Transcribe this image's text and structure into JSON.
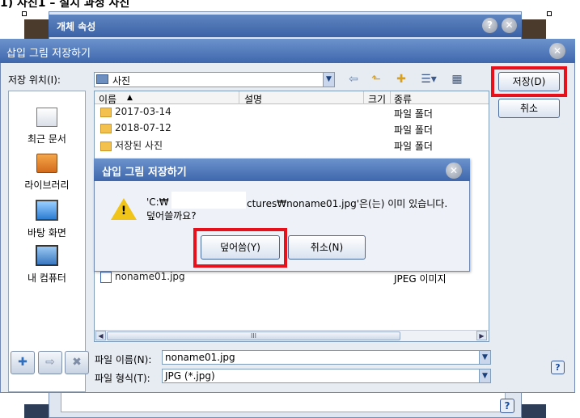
{
  "doc_caption": "1) 사진1 – 설치 과정 사진",
  "bg_window": {
    "title": "개체 속성",
    "help_glyph": "?",
    "close_glyph": "✕"
  },
  "save_dialog": {
    "title": "삽입 그림 저장하기",
    "close_glyph": "✕",
    "location_label": "저장 위치(I):",
    "location_value": "사진",
    "places": [
      {
        "label": "최근 문서",
        "icon": "recent-documents-icon"
      },
      {
        "label": "라이브러리",
        "icon": "library-icon"
      },
      {
        "label": "바탕 화면",
        "icon": "desktop-icon"
      },
      {
        "label": "내 컴퓨터",
        "icon": "my-computer-icon"
      }
    ],
    "columns": {
      "name": "이름",
      "desc": "설명",
      "size": "크기",
      "type": "종류",
      "sort_glyph": "▲"
    },
    "files": [
      {
        "name": "2017-03-14",
        "type": "파일 폴더"
      },
      {
        "name": "2018-07-12",
        "type": "파일 폴더"
      },
      {
        "name": "저장된 사진",
        "type": "파일 폴더"
      },
      {
        "name": "noname01.jpg",
        "type": "JPEG 이미지"
      }
    ],
    "scrollbar_thumb_glyph": "III",
    "filename_label": "파일 이름(N):",
    "filename_value": "noname01.jpg",
    "filetype_label": "파일 형식(T):",
    "filetype_value": "JPG (*.jpg)",
    "save_button": "저장(D)",
    "cancel_button": "취소",
    "help_glyph": "?"
  },
  "confirm_dialog": {
    "title": "삽입 그림 저장하기",
    "close_glyph": "✕",
    "message_prefix": "'C:₩",
    "message_suffix": "ctures₩noname01.jpg'은(는) 이미 있습니다.",
    "message_line2": "덮어쓸까요?",
    "overwrite_button": "덮어씀(Y)",
    "cancel_button": "취소(N)"
  },
  "colors": {
    "highlight": "#e8101a",
    "titlebar": "#3e67ad",
    "dialog_bg": "#e7ecf3"
  }
}
